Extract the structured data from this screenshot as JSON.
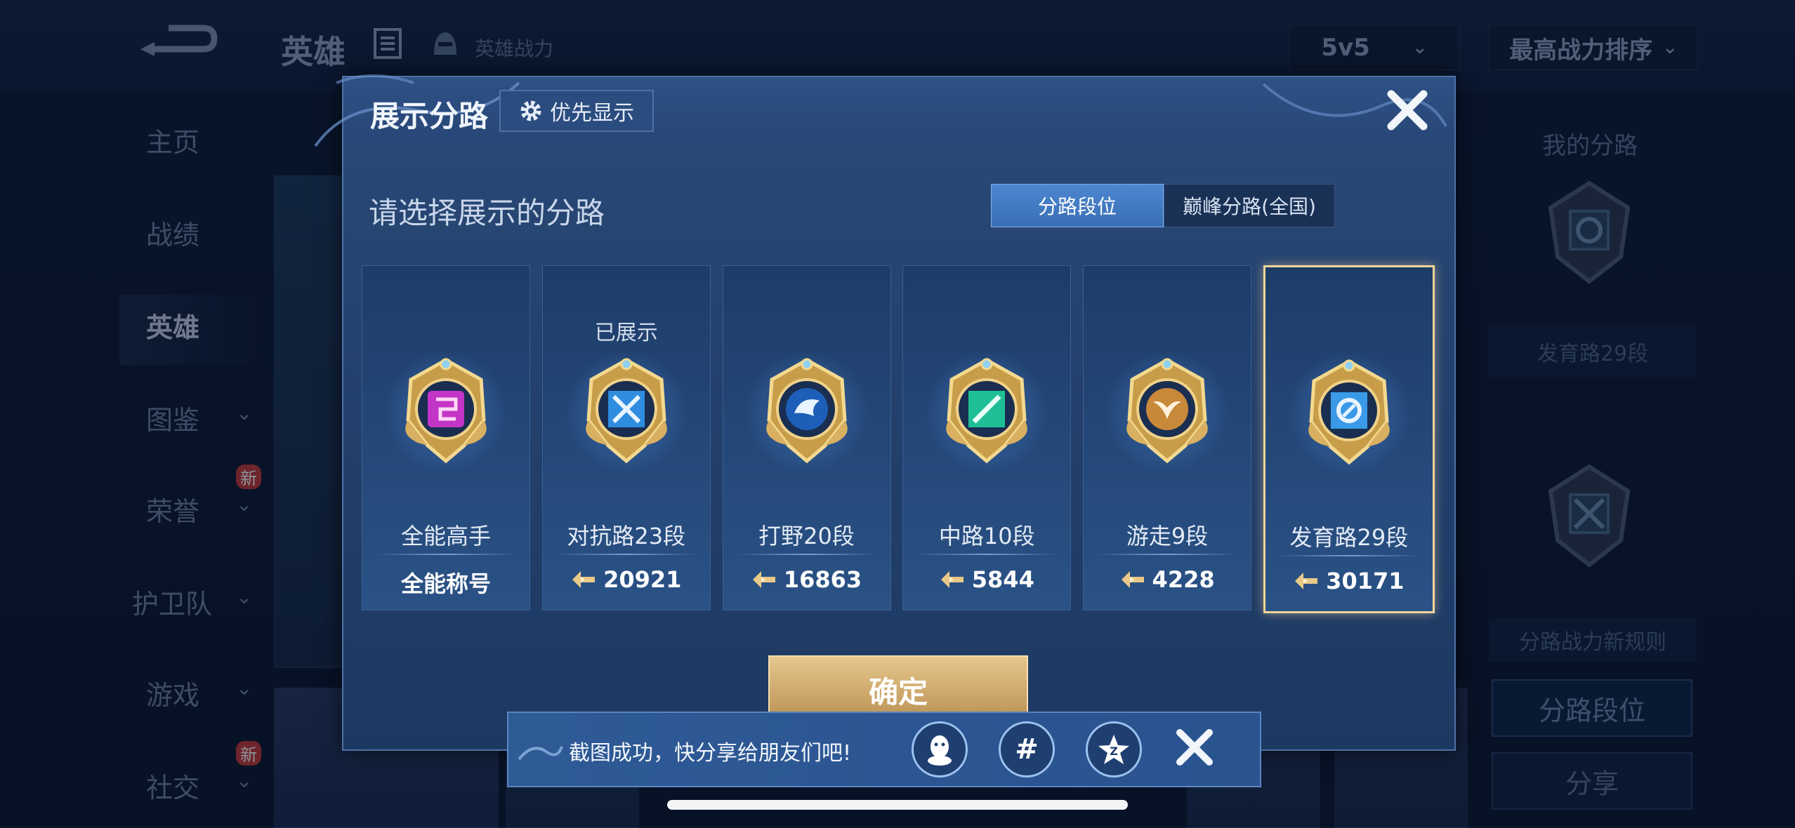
{
  "background": {
    "title": "英雄",
    "hero_power_label": "英雄战力",
    "mode": "5v5",
    "sort": "最高战力排序",
    "nav": [
      {
        "label": "主页",
        "chevron": false,
        "badge": ""
      },
      {
        "label": "战绩",
        "chevron": false,
        "badge": ""
      },
      {
        "label": "英雄",
        "chevron": false,
        "badge": "",
        "active": true
      },
      {
        "label": "图鉴",
        "chevron": true,
        "badge": ""
      },
      {
        "label": "荣誉",
        "chevron": true,
        "badge": "新"
      },
      {
        "label": "护卫队",
        "chevron": true,
        "badge": ""
      },
      {
        "label": "游戏",
        "chevron": true,
        "badge": ""
      },
      {
        "label": "社交",
        "chevron": true,
        "badge": "新"
      }
    ],
    "right_panel": {
      "title": "我的分路",
      "lane_label": "发育路29段",
      "rule_label": "分路战力新规则",
      "lane_button": "分路段位",
      "share_button": "分享"
    }
  },
  "dialog": {
    "title": "展示分路",
    "priority_button": "优先显示",
    "subtitle": "请选择展示的分路",
    "tabs": [
      "分路段位",
      "巅峰分路(全国)"
    ],
    "cards": [
      {
        "status": "",
        "name": "全能高手",
        "value": "全能称号",
        "has_icon": false,
        "emblem_color": "#c235c6",
        "emblem": "allround"
      },
      {
        "status": "已展示",
        "name": "对抗路23段",
        "value": "20921",
        "has_icon": true,
        "emblem_color": "#2f8de0",
        "emblem": "clash"
      },
      {
        "status": "",
        "name": "打野20段",
        "value": "16863",
        "has_icon": true,
        "emblem_color": "#1d5fb8",
        "emblem": "jungle"
      },
      {
        "status": "",
        "name": "中路10段",
        "value": "5844",
        "has_icon": true,
        "emblem_color": "#1fbf95",
        "emblem": "mid"
      },
      {
        "status": "",
        "name": "游走9段",
        "value": "4228",
        "has_icon": true,
        "emblem_color": "#c9893a",
        "emblem": "roam"
      },
      {
        "status": "",
        "name": "发育路29段",
        "value": "30171",
        "has_icon": true,
        "emblem_color": "#3a9ae8",
        "emblem": "farm",
        "selected": true
      }
    ],
    "confirm_button": "确定"
  },
  "toast": {
    "text": "截图成功，快分享给朋友们吧!"
  },
  "colors": {
    "gold": "#f0d49a",
    "tab_active": "#4c87d0",
    "dialog_bg": "#23416c"
  }
}
